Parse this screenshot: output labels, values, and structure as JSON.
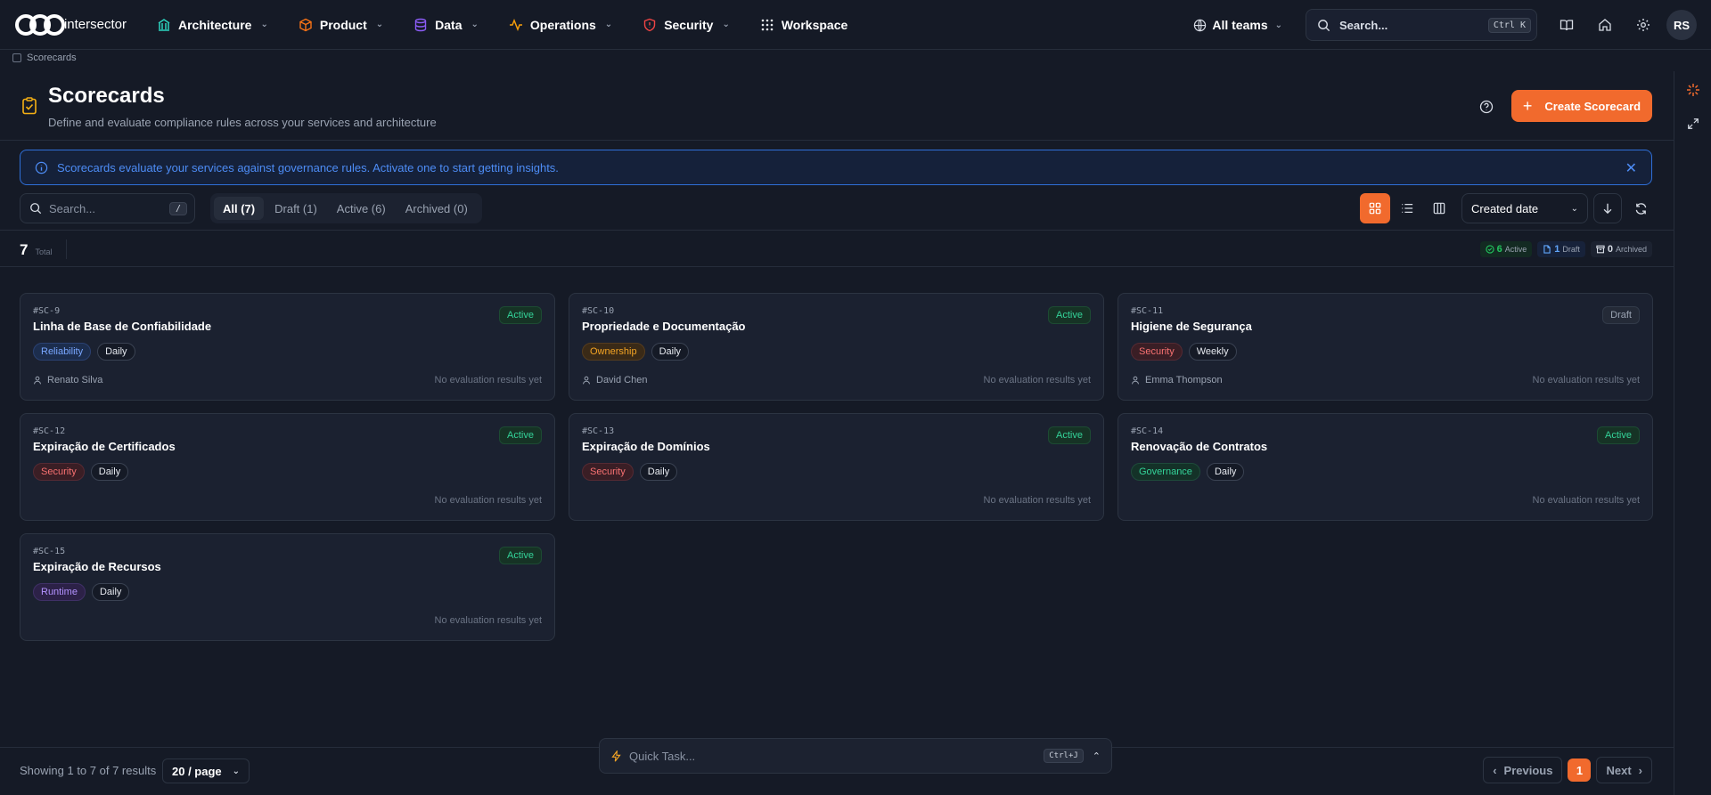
{
  "app": {
    "name": "intersector"
  },
  "nav": {
    "items": [
      {
        "label": "Architecture",
        "icon": "building-icon",
        "color": "#2dd4bf"
      },
      {
        "label": "Product",
        "icon": "cube-icon",
        "color": "#f97316"
      },
      {
        "label": "Data",
        "icon": "database-icon",
        "color": "#8b5cf6"
      },
      {
        "label": "Operations",
        "icon": "activity-icon",
        "color": "#f59e0b"
      },
      {
        "label": "Security",
        "icon": "shield-icon",
        "color": "#ef4444"
      },
      {
        "label": "Workspace",
        "icon": "grid-icon",
        "color": "#e6e9ef"
      }
    ],
    "teams_label": "All teams",
    "search_placeholder": "Search...",
    "search_shortcut": "Ctrl K",
    "avatar_initials": "RS"
  },
  "breadcrumb": {
    "current": "Scorecards"
  },
  "header": {
    "title": "Scorecards",
    "subtitle": "Define and evaluate compliance rules across your services and architecture",
    "create_label": "Create Scorecard"
  },
  "banner": {
    "text": "Scorecards evaluate your services against governance rules. Activate one to start getting insights."
  },
  "toolbar": {
    "search_placeholder": "Search...",
    "search_shortcut": "/",
    "tabs": [
      {
        "label": "All (7)",
        "active": true
      },
      {
        "label": "Draft (1)",
        "active": false
      },
      {
        "label": "Active (6)",
        "active": false
      },
      {
        "label": "Archived (0)",
        "active": false
      }
    ],
    "sort_label": "Created date"
  },
  "stats": {
    "total": "7",
    "total_label": "Total",
    "active_count": "6",
    "active_label": "Active",
    "draft_count": "1",
    "draft_label": "Draft",
    "archived_count": "0",
    "archived_label": "Archived"
  },
  "cards": [
    {
      "id": "#SC-9",
      "name": "Linha de Base de Confiabilidade",
      "status": "Active",
      "category": "Reliability",
      "category_class": "reliability",
      "cadence": "Daily",
      "owner": "Renato Silva",
      "eval": "No evaluation results yet"
    },
    {
      "id": "#SC-10",
      "name": "Propriedade e Documentação",
      "status": "Active",
      "category": "Ownership",
      "category_class": "ownership",
      "cadence": "Daily",
      "owner": "David Chen",
      "eval": "No evaluation results yet"
    },
    {
      "id": "#SC-11",
      "name": "Higiene de Segurança",
      "status": "Draft",
      "category": "Security",
      "category_class": "security",
      "cadence": "Weekly",
      "owner": "Emma Thompson",
      "eval": "No evaluation results yet"
    },
    {
      "id": "#SC-12",
      "name": "Expiração de Certificados",
      "status": "Active",
      "category": "Security",
      "category_class": "security",
      "cadence": "Daily",
      "owner": "",
      "eval": "No evaluation results yet"
    },
    {
      "id": "#SC-13",
      "name": "Expiração de Domínios",
      "status": "Active",
      "category": "Security",
      "category_class": "security",
      "cadence": "Daily",
      "owner": "",
      "eval": "No evaluation results yet"
    },
    {
      "id": "#SC-14",
      "name": "Renovação de Contratos",
      "status": "Active",
      "category": "Governance",
      "category_class": "governance",
      "cadence": "Daily",
      "owner": "",
      "eval": "No evaluation results yet"
    },
    {
      "id": "#SC-15",
      "name": "Expiração de Recursos",
      "status": "Active",
      "category": "Runtime",
      "category_class": "runtime",
      "cadence": "Daily",
      "owner": "",
      "eval": "No evaluation results yet"
    }
  ],
  "footer": {
    "showing": "Showing 1 to 7 of 7 results",
    "per_page": "20 / page",
    "prev_label": "Previous",
    "next_label": "Next",
    "current_page": "1"
  },
  "quick_task": {
    "placeholder": "Quick Task...",
    "shortcut": "Ctrl+J"
  },
  "colors": {
    "accent": "#f16a2d",
    "background": "#151a26",
    "info": "#4d8cf5"
  }
}
